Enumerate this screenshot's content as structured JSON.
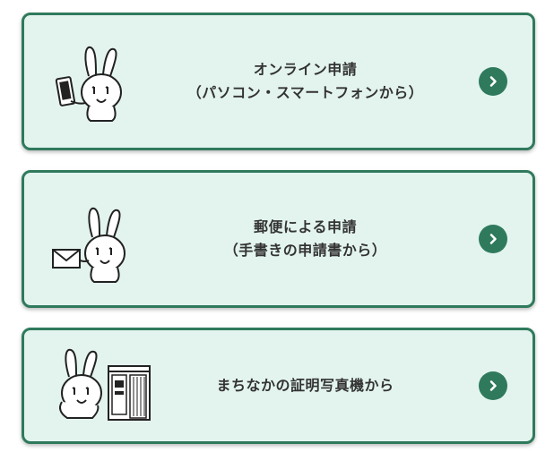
{
  "options": [
    {
      "line1": "オンライン申請",
      "line2": "（パソコン・スマートフォンから）"
    },
    {
      "line1": "郵便による申請",
      "line2": "（手書きの申請書から）"
    },
    {
      "line1": "まちなかの証明写真機から",
      "line2": ""
    }
  ],
  "icons": {
    "arrow": "chevron-right-icon",
    "mascot": "rabbit-mascot-icon"
  },
  "colors": {
    "card_bg": "#e3f4ef",
    "accent": "#2f7a5d",
    "text": "#333333"
  }
}
